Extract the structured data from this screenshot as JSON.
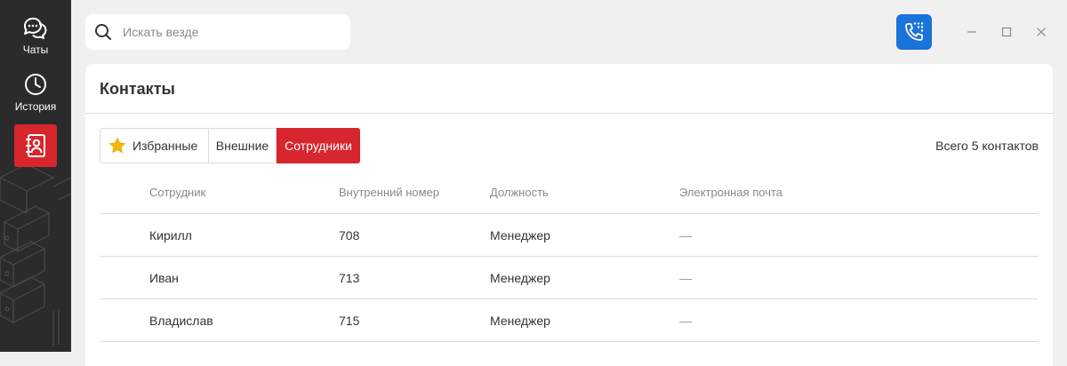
{
  "sidebar": {
    "items": [
      {
        "label": "Чаты",
        "icon": "chat-icon"
      },
      {
        "label": "История",
        "icon": "clock-icon"
      },
      {
        "label": "",
        "icon": "contacts-book-icon",
        "active": true
      }
    ]
  },
  "search": {
    "placeholder": "Искать везде",
    "value": ""
  },
  "header": {
    "call_icon": "phone-dialpad-icon"
  },
  "panel": {
    "title": "Контакты",
    "tabs": [
      "Избранные",
      "Внешние",
      "Сотрудники"
    ],
    "active_tab": "Сотрудники",
    "total": "Всего 5 контактов"
  },
  "table": {
    "columns": [
      "Сотрудник",
      "Внутренний номер",
      "Должность",
      "Электронная почта"
    ],
    "rows": [
      {
        "name": "Кирилл",
        "ext": "708",
        "position": "Менеджер",
        "email": "—"
      },
      {
        "name": "Иван",
        "ext": "713",
        "position": "Менеджер",
        "email": "—"
      },
      {
        "name": "Владислав",
        "ext": "715",
        "position": "Менеджер",
        "email": "—"
      }
    ]
  },
  "colors": {
    "accent_red": "#d8262e",
    "accent_blue": "#1a73d9",
    "sidebar": "#2b2b2b"
  }
}
